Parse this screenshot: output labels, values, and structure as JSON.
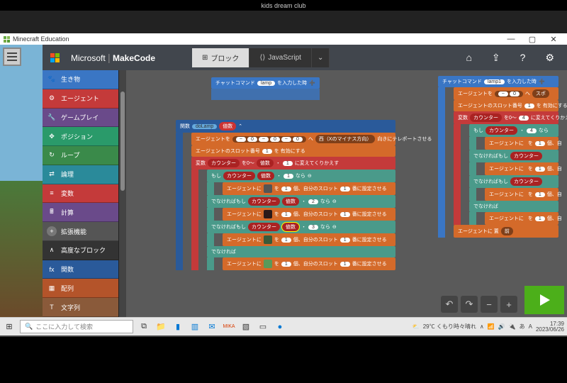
{
  "chrome_tab": "kids dream club",
  "window": {
    "title": "Minecraft Education",
    "min": "—",
    "max": "▢",
    "close": "✕"
  },
  "header": {
    "brand_a": "Microsoft",
    "brand_b": "MakeCode",
    "tab_blocks": "ブロック",
    "tab_js": "JavaScript"
  },
  "toolbox": [
    {
      "label": "生き物",
      "color": "#3a76c4",
      "icon": "🐾"
    },
    {
      "label": "エージェント",
      "color": "#c43a3a",
      "icon": "⚙"
    },
    {
      "label": "ゲームプレイ",
      "color": "#6a4a8a",
      "icon": "🔧"
    },
    {
      "label": "ポジション",
      "color": "#2a9a6a",
      "icon": "✥"
    },
    {
      "label": "ループ",
      "color": "#3a8a4a",
      "icon": "↻"
    },
    {
      "label": "論理",
      "color": "#2a8a9a",
      "icon": "⇄"
    },
    {
      "label": "変数",
      "color": "#c43a3a",
      "icon": "≡"
    },
    {
      "label": "計算",
      "color": "#6a4a8a",
      "icon": "🖩"
    },
    {
      "label": "拡張機能",
      "color": "#555",
      "icon": "+"
    },
    {
      "label": "高度なブロック",
      "color": "#333",
      "icon": "∧"
    },
    {
      "label": "関数",
      "color": "#2a5a9a",
      "icon": "fx"
    },
    {
      "label": "配列",
      "color": "#b4542a",
      "icon": "▦"
    },
    {
      "label": "文字列",
      "color": "#8a5a3a",
      "icon": "T"
    }
  ],
  "blocks": {
    "chat1": {
      "head": "チャットコマンド",
      "cmd": "lamp",
      "tail": "を入力した時"
    },
    "chat2": {
      "head": "チャットコマンド",
      "cmd": "lamp1",
      "tail": "を入力した時"
    },
    "func": {
      "head": "関数",
      "name": "doLamp",
      "param": "値数"
    },
    "teleport": {
      "a": "エージェントを",
      "vals": [
        "0",
        "0",
        "0"
      ],
      "dir": "西（Xのマイナス方向）",
      "tail": "向きにテレポートさせる"
    },
    "slot1": {
      "a": "エージェントのスロット番号",
      "n": "1",
      "tail": "を 有効にする"
    },
    "loop": {
      "a": "変数",
      "var": "カウンター",
      "b": "を0～",
      "var2": "値数",
      "n": "1",
      "tail": "に変えてくりかえす"
    },
    "if": {
      "a": "もし",
      "var": "カウンター",
      "op": "値数",
      "dot": "・",
      "n": "1",
      "tail": "なら"
    },
    "set": {
      "a": "エージェントに",
      "b": "を",
      "n1": "1",
      "c": "個、自分のスロット",
      "n2": "1",
      "d": "番に設定させる"
    },
    "elif": {
      "a": "でなければもし",
      "var": "カウンター",
      "op": "値数",
      "n": "2",
      "tail": "なら"
    },
    "n3": "3",
    "else": "でなければ",
    "right": {
      "a1": "エージェントを",
      "v": "0",
      "sp": "スポ",
      "slot": "エージェントのスロット番号",
      "n1": "1",
      "tail1": "を 有効にする",
      "loop_a": "変数",
      "loop_var": "カウンター",
      "loop_b": "を0～",
      "loop_n": "4",
      "loop_tail": "に変えてくりかえす",
      "if_a": "もし",
      "if_var": "カウンター",
      "if_n": "4",
      "if_tail": "なら",
      "set_a": "エージェントに",
      "set_b": "を",
      "set_n": "1",
      "set_c": "個、自",
      "elif_a": "でなければもし",
      "elif_var": "カウンター",
      "place": "エージェントに 置",
      "fwd": "前"
    }
  },
  "taskbar": {
    "search_placeholder": "ここに入力して検索",
    "weather": "29℃ くもり時々晴れ",
    "time": "17:39",
    "date": "2023/06/26"
  }
}
